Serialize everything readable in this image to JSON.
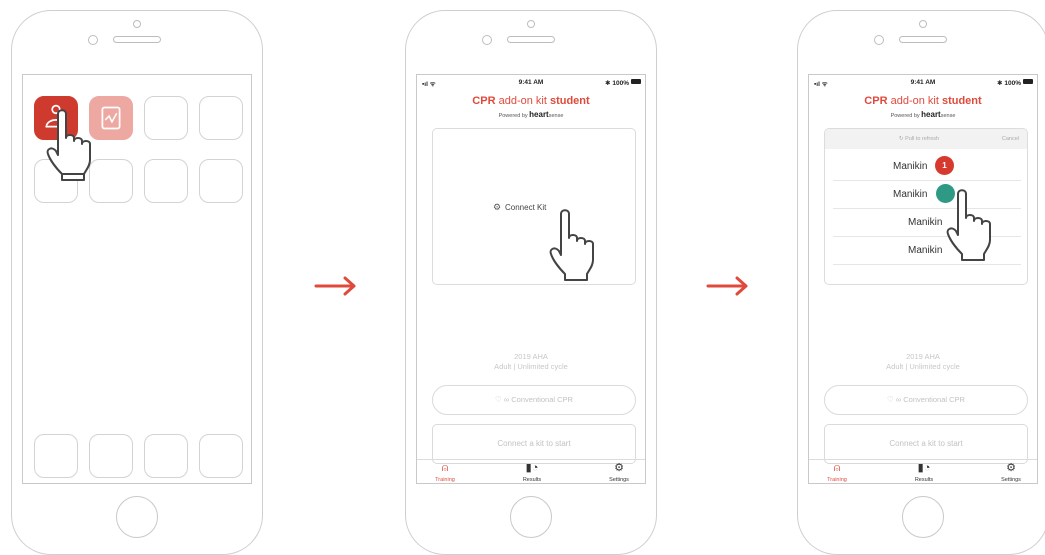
{
  "phone2": {
    "status": {
      "time": "9:41 AM",
      "battery": "✱ 100%"
    },
    "brand": {
      "cpr": "CPR",
      "mid": " add-on kit ",
      "student": "student"
    },
    "powered": {
      "text": "Powered by ",
      "heart": "heart",
      "sense": "sense"
    },
    "connect_label": "Connect Kit",
    "protocol_line1": "2019 AHA",
    "protocol_line2": "Adult | Unlimited cycle",
    "mode_button": "Conventional CPR",
    "start_label": "Connect a kit to start",
    "tabs": [
      {
        "label": "Training"
      },
      {
        "label": "Results"
      },
      {
        "label": "Settings"
      }
    ]
  },
  "phone3": {
    "status": {
      "time": "9:41 AM",
      "battery": "✱ 100%"
    },
    "brand": {
      "cpr": "CPR",
      "mid": " add-on kit ",
      "student": "student"
    },
    "powered": {
      "text": "Powered by ",
      "heart": "heart",
      "sense": "sense"
    },
    "refresh_label": "Pull to refresh",
    "cancel_label": "Cancel",
    "manikins": [
      {
        "label": "Manikin",
        "badge": "1"
      },
      {
        "label": "Manikin",
        "badge": ""
      },
      {
        "label": "Manikin",
        "badge": ""
      },
      {
        "label": "Manikin",
        "badge": ""
      }
    ],
    "protocol_line1": "2019 AHA",
    "protocol_line2": "Adult | Unlimited cycle",
    "mode_button": "Conventional CPR",
    "start_label": "Connect a kit to start",
    "tabs": [
      {
        "label": "Training"
      },
      {
        "label": "Results"
      },
      {
        "label": "Settings"
      }
    ]
  },
  "colors": {
    "accent": "#e04a3c",
    "app_red": "#cf3a2e",
    "app_pink": "#eea8a2",
    "teal": "#2e9a86",
    "arrow": "#e04a3c"
  },
  "icons": [
    "hand-pointer-icon",
    "arrow-right-icon",
    "bluetooth-kit-icon",
    "lungs-icon",
    "training-icon",
    "results-icon",
    "settings-gear-icon",
    "refresh-icon"
  ]
}
